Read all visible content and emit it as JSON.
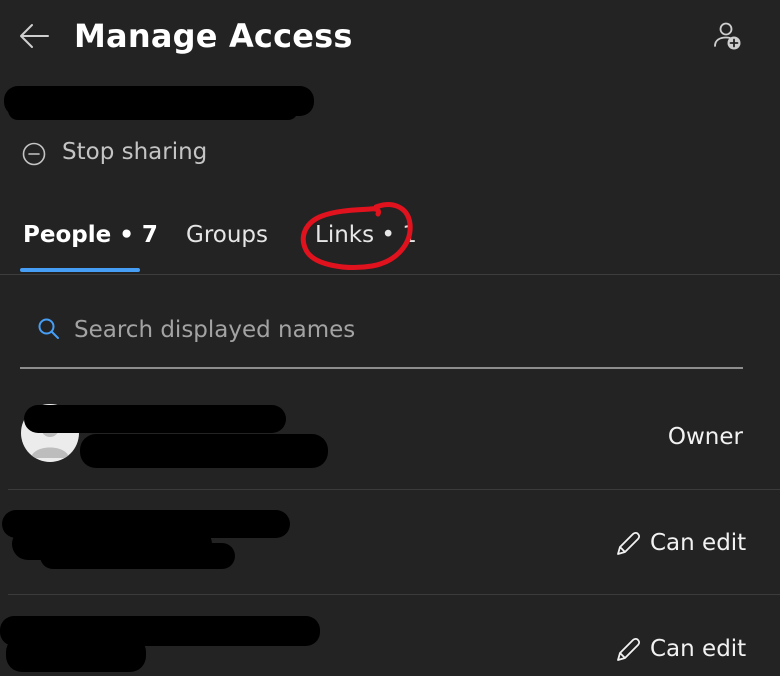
{
  "header": {
    "title": "Manage Access",
    "back_icon": "arrow-left-icon",
    "add_icon": "person-add-icon"
  },
  "stop_sharing": {
    "label": "Stop sharing",
    "icon": "minus-circle-icon"
  },
  "tabs": [
    {
      "label": "People • 7",
      "active": true
    },
    {
      "label": "Groups",
      "active": false
    },
    {
      "label": "Links • 1",
      "active": false
    }
  ],
  "search": {
    "placeholder": "Search displayed names",
    "icon": "search-icon"
  },
  "people": [
    {
      "role": "Owner"
    },
    {
      "role": "Can edit",
      "icon": "pencil-icon"
    },
    {
      "role": "Can edit",
      "icon": "pencil-icon"
    }
  ],
  "colors": {
    "background": "#232323",
    "accent": "#479ef5",
    "annotation": "#e0121e"
  }
}
